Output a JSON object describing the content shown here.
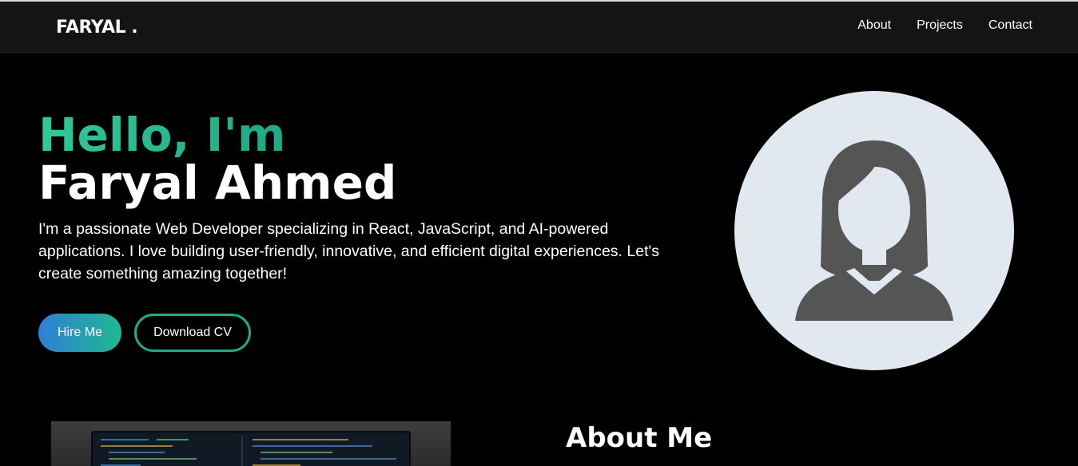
{
  "brand": {
    "logo": "FARYAL ."
  },
  "nav": {
    "items": [
      "About",
      "Projects",
      "Contact"
    ]
  },
  "hero": {
    "greeting": "Hello, I'm",
    "name": "Faryal Ahmed",
    "description": "I'm a passionate Web Developer specializing in React, JavaScript, and AI-powered applications. I love building user-friendly, innovative, and efficient digital experiences. Let's create something amazing together!",
    "hire_label": "Hire Me",
    "cv_label": "Download CV"
  },
  "about": {
    "title": "About Me"
  },
  "icons": {
    "avatar": "user-avatar-female-icon"
  },
  "colors": {
    "background": "#000000",
    "navbar": "#141414",
    "accent_green": "#2fc99a",
    "accent_blue": "#2f7fd8",
    "avatar_bg": "#e2e8f0",
    "avatar_figure": "#555555"
  }
}
